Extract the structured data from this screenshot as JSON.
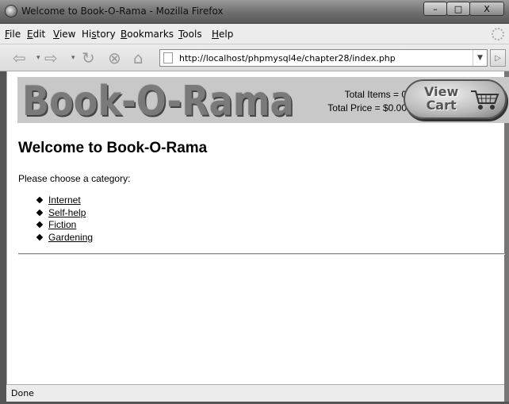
{
  "window": {
    "title": "Welcome to Book-O-Rama - Mozilla Firefox",
    "minimize": "–",
    "maximize": "□",
    "close": "X"
  },
  "menu": [
    {
      "accel": "F",
      "rest": "ile"
    },
    {
      "accel": "E",
      "rest": "dit"
    },
    {
      "accel": "V",
      "rest": "iew"
    },
    {
      "pre": "Hi",
      "accel": "s",
      "rest": "tory"
    },
    {
      "accel": "B",
      "rest": "ookmarks"
    },
    {
      "accel": "T",
      "rest": "ools"
    },
    {
      "accel": "H",
      "rest": "elp"
    }
  ],
  "nav": {
    "url": "http://localhost/phpmysql4e/chapter28/index.php"
  },
  "header": {
    "logo": "Book-O-Rama",
    "total_items": "Total Items = 0",
    "total_price": "Total Price = $0.00",
    "view_cart_line1": "View",
    "view_cart_line2": "Cart"
  },
  "main": {
    "heading": "Welcome to Book-O-Rama",
    "prompt": "Please choose a category:",
    "categories": [
      "Internet",
      "Self-help",
      "Fiction",
      "Gardening"
    ]
  },
  "status": {
    "text": "Done"
  },
  "colors": {
    "header_band": "#c8c8c8",
    "logo": "#7a7a7a"
  }
}
